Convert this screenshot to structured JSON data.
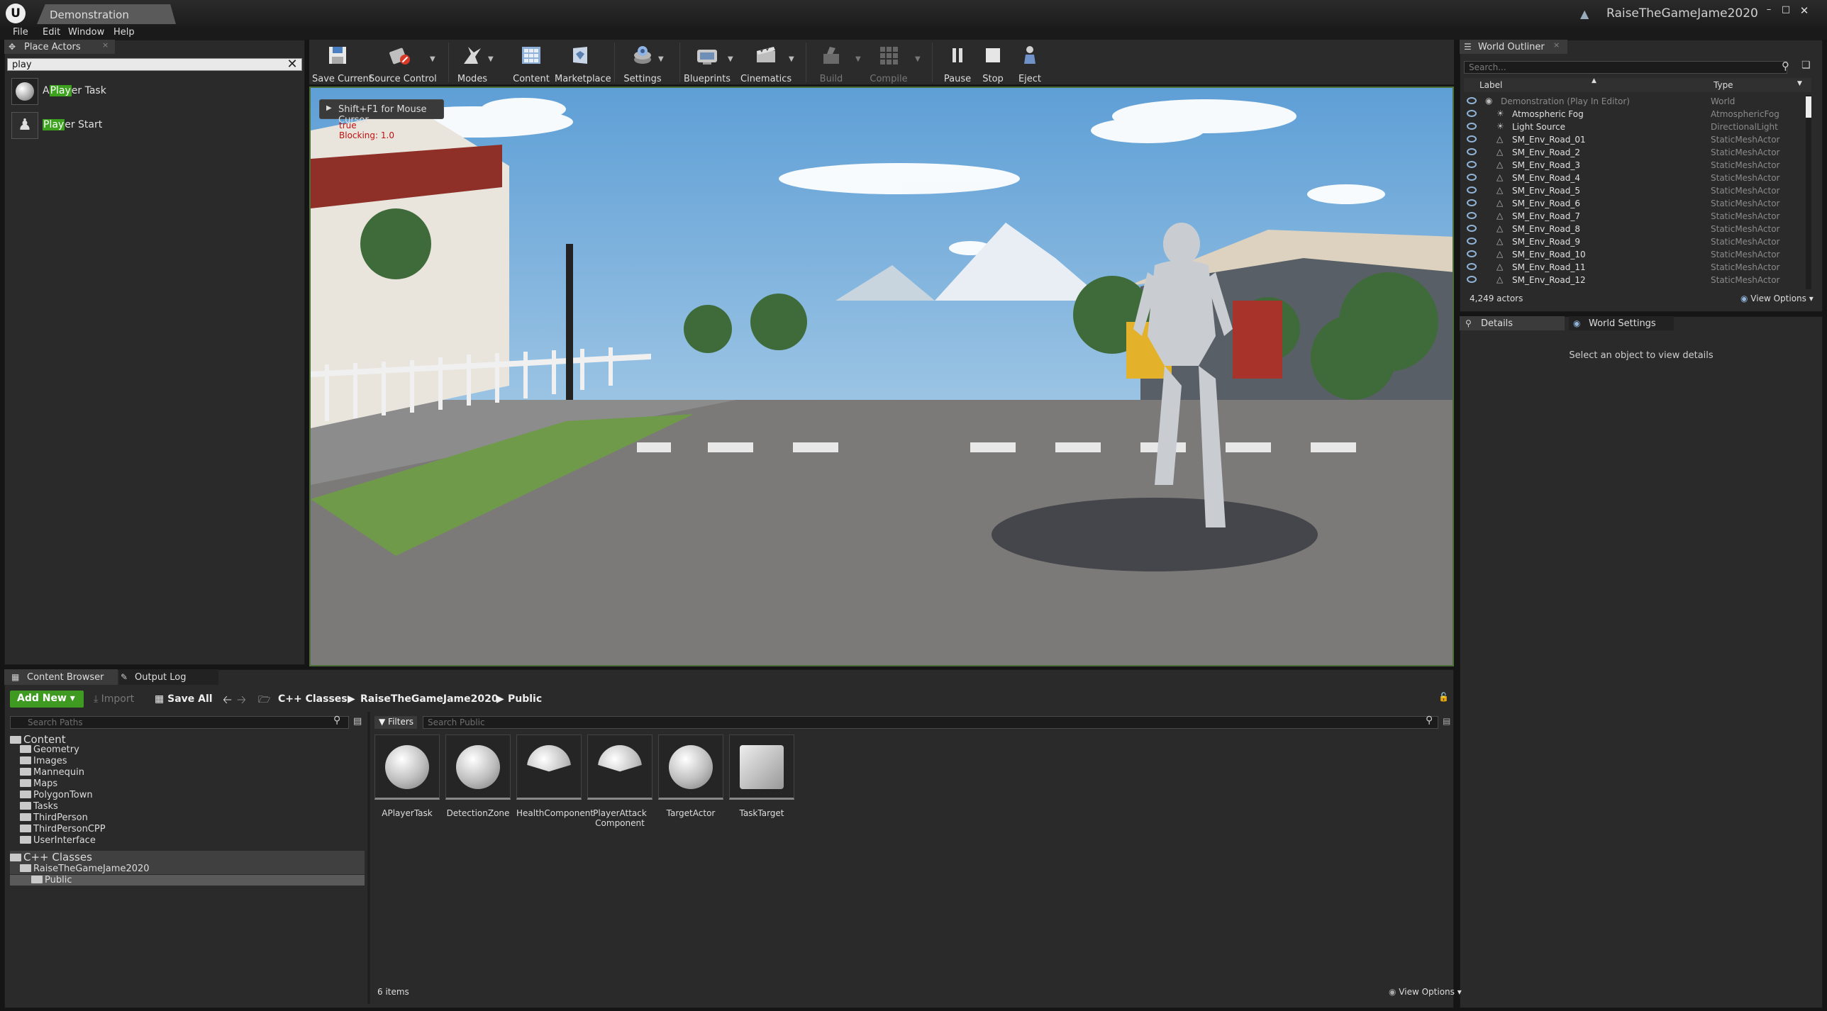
{
  "window": {
    "tab_title": "Demonstration",
    "project_name": "RaiseTheGameJame2020"
  },
  "menu": [
    "File",
    "Edit",
    "Window",
    "Help"
  ],
  "place_actors": {
    "tab_label": "Place Actors",
    "search_value": "play",
    "items": [
      {
        "pre": "A",
        "match": "Play",
        "post": "er Task"
      },
      {
        "pre": "",
        "match": "Play",
        "post": "er Start"
      }
    ]
  },
  "toolbar": {
    "buttons": [
      {
        "label": "Save Current",
        "icon": "save-icon"
      },
      {
        "label": "Source Control",
        "icon": "source-control-icon"
      },
      {
        "label": "Modes",
        "icon": "modes-icon"
      },
      {
        "label": "Content",
        "icon": "content-icon"
      },
      {
        "label": "Marketplace",
        "icon": "marketplace-icon"
      },
      {
        "label": "Settings",
        "icon": "settings-icon"
      },
      {
        "label": "Blueprints",
        "icon": "blueprints-icon"
      },
      {
        "label": "Cinematics",
        "icon": "cinematics-icon"
      },
      {
        "label": "Build",
        "icon": "build-icon"
      },
      {
        "label": "Compile",
        "icon": "compile-icon"
      },
      {
        "label": "Pause",
        "icon": "pause-icon"
      },
      {
        "label": "Stop",
        "icon": "stop-icon"
      },
      {
        "label": "Eject",
        "icon": "eject-icon"
      }
    ]
  },
  "viewport": {
    "hint": "Shift+F1 for Mouse Cursor",
    "debug_line1": "true",
    "debug_line2": "Blocking: 1.0"
  },
  "outliner": {
    "tab_label": "World Outliner",
    "search_placeholder": "Search...",
    "col_label": "Label",
    "col_type": "Type",
    "rows": [
      {
        "name": "Demonstration (Play In Editor)",
        "type": "World"
      },
      {
        "name": "Atmospheric Fog",
        "type": "AtmosphericFog"
      },
      {
        "name": "Light Source",
        "type": "DirectionalLight"
      },
      {
        "name": "SM_Env_Road_01",
        "type": "StaticMeshActor"
      },
      {
        "name": "SM_Env_Road_2",
        "type": "StaticMeshActor"
      },
      {
        "name": "SM_Env_Road_3",
        "type": "StaticMeshActor"
      },
      {
        "name": "SM_Env_Road_4",
        "type": "StaticMeshActor"
      },
      {
        "name": "SM_Env_Road_5",
        "type": "StaticMeshActor"
      },
      {
        "name": "SM_Env_Road_6",
        "type": "StaticMeshActor"
      },
      {
        "name": "SM_Env_Road_7",
        "type": "StaticMeshActor"
      },
      {
        "name": "SM_Env_Road_8",
        "type": "StaticMeshActor"
      },
      {
        "name": "SM_Env_Road_9",
        "type": "StaticMeshActor"
      },
      {
        "name": "SM_Env_Road_10",
        "type": "StaticMeshActor"
      },
      {
        "name": "SM_Env_Road_11",
        "type": "StaticMeshActor"
      },
      {
        "name": "SM_Env_Road_12",
        "type": "StaticMeshActor"
      }
    ],
    "count": "4,249 actors",
    "view_options": "View Options"
  },
  "details": {
    "tab_label": "Details",
    "world_settings_label": "World Settings",
    "empty_message": "Select an object to view details"
  },
  "content_browser": {
    "tab_label": "Content Browser",
    "log_tab_label": "Output Log",
    "add_new": "Add New",
    "import": "Import",
    "save_all": "Save All",
    "breadcrumb": [
      "C++ Classes",
      "RaiseTheGameJame2020",
      "Public"
    ],
    "paths_placeholder": "Search Paths",
    "filters": "Filters",
    "search_placeholder": "Search Public",
    "tree": [
      {
        "label": "Content",
        "level": 0
      },
      {
        "label": "Geometry",
        "level": 1
      },
      {
        "label": "Images",
        "level": 1
      },
      {
        "label": "Mannequin",
        "level": 1
      },
      {
        "label": "Maps",
        "level": 1
      },
      {
        "label": "PolygonTown",
        "level": 1
      },
      {
        "label": "Tasks",
        "level": 1
      },
      {
        "label": "ThirdPerson",
        "level": 1
      },
      {
        "label": "ThirdPersonCPP",
        "level": 1
      },
      {
        "label": "UserInterface",
        "level": 1
      },
      {
        "label": "C++ Classes",
        "level": 0
      },
      {
        "label": "RaiseTheGameJame2020",
        "level": 1
      },
      {
        "label": "Public",
        "level": 2
      }
    ],
    "assets": [
      {
        "l1": "APlayerTask",
        "l2": ""
      },
      {
        "l1": "DetectionZone",
        "l2": ""
      },
      {
        "l1": "HealthComponent",
        "l2": ""
      },
      {
        "l1": "PlayerAttack",
        "l2": "Component"
      },
      {
        "l1": "TargetActor",
        "l2": ""
      },
      {
        "l1": "TaskTarget",
        "l2": ""
      }
    ],
    "item_count": "6 items",
    "view_options": "View Options"
  }
}
